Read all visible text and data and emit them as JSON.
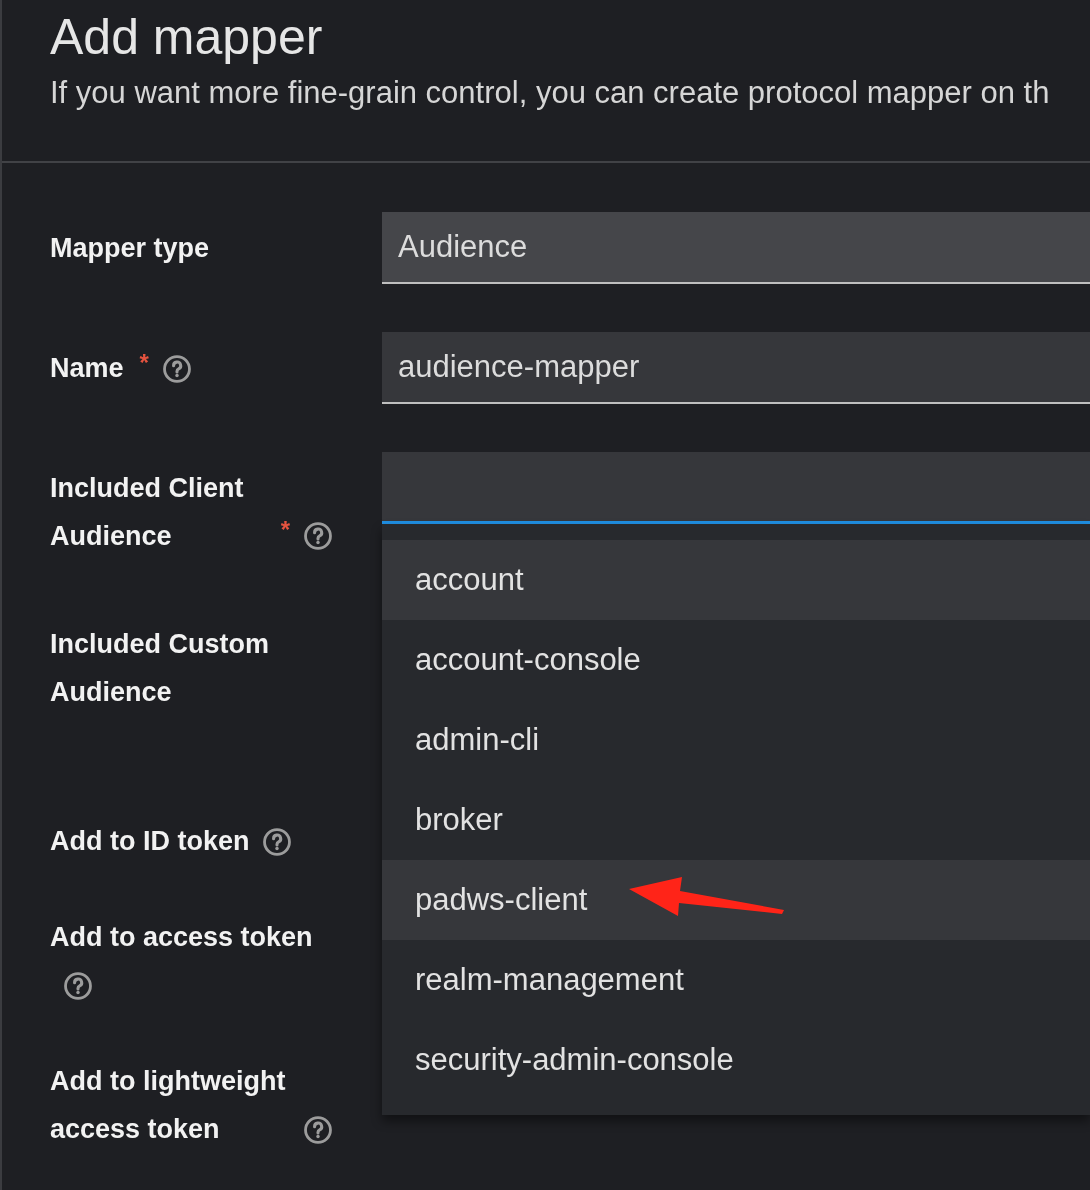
{
  "header": {
    "title": "Add mapper",
    "description": "If you want more fine-grain control, you can create protocol mapper on th"
  },
  "form": {
    "fields": [
      {
        "kind": "readonly",
        "label": "Mapper type",
        "help": false,
        "focused": false,
        "value": "Audience"
      },
      {
        "kind": "text",
        "label": "Name",
        "required_mark": "*",
        "help": true,
        "focused": false,
        "value": "audience-mapper"
      },
      {
        "kind": "typeahead",
        "label": "Included Client Audience",
        "required_mark": "*",
        "help": true,
        "focused": true,
        "options": [
          {
            "label": "account",
            "highlighted": true,
            "annotated": false
          },
          {
            "label": "account-console",
            "highlighted": false,
            "annotated": false
          },
          {
            "label": "admin-cli",
            "highlighted": false,
            "annotated": false
          },
          {
            "label": "broker",
            "highlighted": false,
            "annotated": false
          },
          {
            "label": "padws-client",
            "highlighted": true,
            "annotated": true
          },
          {
            "label": "realm-management",
            "highlighted": false,
            "annotated": false
          },
          {
            "label": "security-admin-console",
            "highlighted": false,
            "annotated": false
          }
        ]
      },
      {
        "kind": "covered_text",
        "label": "Included Custom Audience",
        "help": false
      },
      {
        "kind": "covered_switch",
        "label": "Add to ID token",
        "help": true
      },
      {
        "kind": "covered_switch",
        "label": "Add to access token",
        "help": true
      },
      {
        "kind": "covered_switch",
        "label": "Add to lightweight access token",
        "help": true
      }
    ]
  }
}
